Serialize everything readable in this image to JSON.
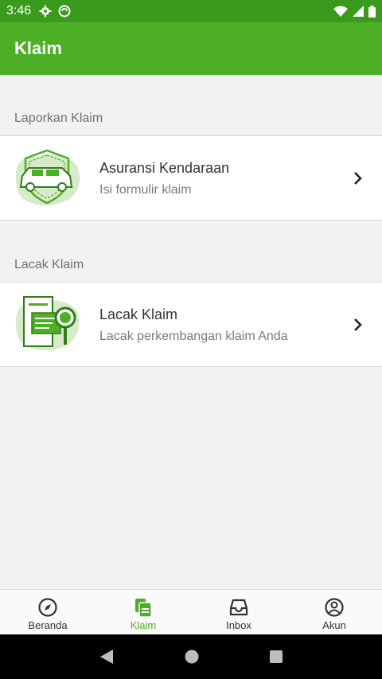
{
  "status_bar": {
    "time": "3:46"
  },
  "app_bar": {
    "title": "Klaim"
  },
  "sections": {
    "report": {
      "label": "Laporkan Klaim",
      "card": {
        "title": "Asuransi Kendaraan",
        "subtitle": "Isi formulir klaim",
        "icon": "car-shield-illustration"
      }
    },
    "track": {
      "label": "Lacak Klaim",
      "card": {
        "title": "Lacak Klaim",
        "subtitle": "Lacak perkembangan klaim Anda",
        "icon": "document-search-illustration"
      }
    }
  },
  "bottom_nav": {
    "items": [
      {
        "label": "Beranda",
        "icon": "compass-icon",
        "active": false
      },
      {
        "label": "Klaim",
        "icon": "documents-icon",
        "active": true
      },
      {
        "label": "Inbox",
        "icon": "inbox-icon",
        "active": false
      },
      {
        "label": "Akun",
        "icon": "account-icon",
        "active": false
      }
    ]
  },
  "colors": {
    "primary": "#4caf26",
    "status_bar": "#3a9a1c",
    "background": "#f2f2f2"
  }
}
